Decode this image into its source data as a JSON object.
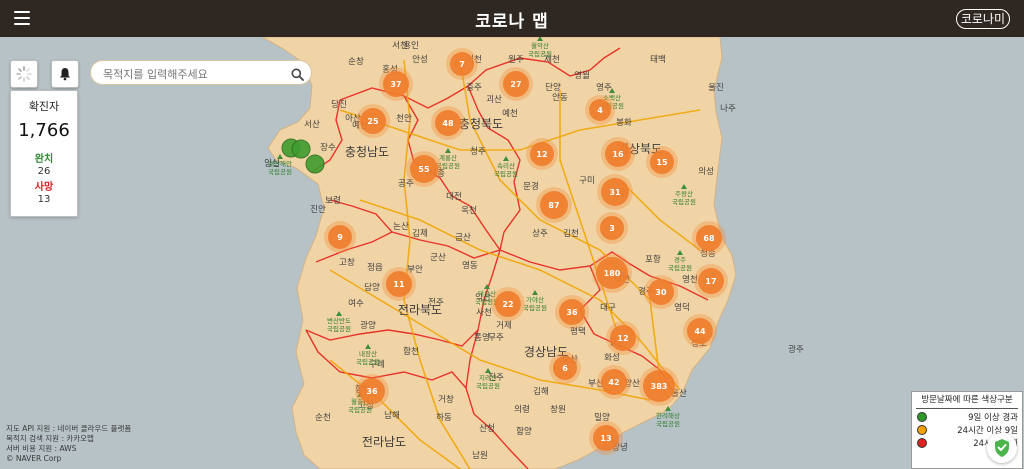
{
  "header": {
    "title": "코로나 맵",
    "menu_icon": "hamburger-icon",
    "corona_button_label": "코로나미"
  },
  "search": {
    "placeholder": "목적지를 입력해주세요",
    "value": ""
  },
  "controls": {
    "location_icon": "location-spinner-icon",
    "notify_icon": "bell-icon"
  },
  "stats": {
    "confirmed_label": "확진자",
    "confirmed_value": "1,766",
    "recovered_label": "완치",
    "recovered_value": "26",
    "deaths_label": "사망",
    "deaths_value": "13"
  },
  "credits": [
    "지도 API 지원 : 네이버 클라우드 플랫폼",
    "목적지 검색 지원 : 카카오맵",
    "서버 비용 지원 : AWS",
    "© NAVER Corp"
  ],
  "legend": {
    "title": "방문날짜에 따른 색상구분",
    "items": [
      {
        "label": "9일 이상 경과",
        "color": "#2f9a2a"
      },
      {
        "label": "24시간 이상 9일",
        "color": "#f2a100"
      },
      {
        "label": "24시간 이내",
        "color": "#e12020"
      }
    ]
  },
  "map": {
    "regions": [
      "충청남도",
      "충청북도",
      "경상북도",
      "전라북도",
      "경상남도",
      "전라남도"
    ],
    "cities": [
      "용인",
      "안성",
      "이천",
      "원주",
      "제천",
      "영월",
      "태백",
      "울진",
      "천안",
      "아산",
      "당진",
      "서산",
      "예산",
      "공주",
      "청주",
      "세종",
      "대전",
      "보령",
      "논산",
      "금산",
      "영동",
      "옥천",
      "괴산",
      "충주",
      "단양",
      "영주",
      "봉화",
      "안동",
      "예천",
      "문경",
      "상주",
      "김천",
      "구미",
      "군위",
      "의성",
      "청송",
      "영덕",
      "포항",
      "경주",
      "영천",
      "대구",
      "경산",
      "청도",
      "울산",
      "양산",
      "부산",
      "김해",
      "창원",
      "진주",
      "사천",
      "통영",
      "거제",
      "합천",
      "거창",
      "함양",
      "산청",
      "남원",
      "구례",
      "광양",
      "순천",
      "여수",
      "담양",
      "정읍",
      "고창",
      "부안",
      "김제",
      "익산",
      "군산",
      "전주",
      "무주",
      "진안",
      "장수",
      "임실",
      "순창",
      "서천",
      "홍성",
      "태안",
      "평택",
      "오산",
      "화성",
      "밀양",
      "창녕",
      "의령",
      "함안",
      "고성",
      "남해",
      "하동",
      "광주",
      "나주",
      "화순",
      "보성",
      "울릉도",
      "동해"
    ],
    "parks": [
      "월악산 국립공원",
      "속리산 국립공원",
      "태안해안 국립공원",
      "주왕산 국립공원",
      "가야산 국립공원",
      "덕유산 국립공원",
      "변산반도 국립공원",
      "내장산 국립공원",
      "지리산 국립공원",
      "한려해상 국립공원",
      "경주 국립공원",
      "계룡산 국립공원",
      "소백산 국립공원",
      "월출산 국립공원"
    ],
    "cluster_labels": [
      "37",
      "7",
      "27",
      "25",
      "48",
      "4",
      "12",
      "16",
      "15",
      "55",
      "31",
      "87",
      "3",
      "9",
      "68",
      "180",
      "11",
      "22",
      "30",
      "17",
      "36",
      "44",
      "12",
      "36",
      "6",
      "42",
      "383",
      "13"
    ]
  }
}
